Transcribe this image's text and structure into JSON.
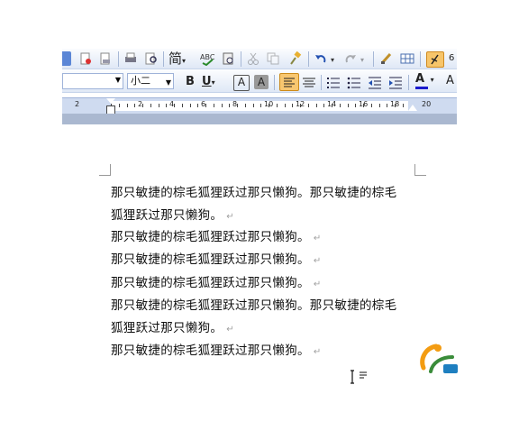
{
  "toolbar": {
    "style_label": "简",
    "font_size": "小二",
    "bold": "B",
    "underline": "U",
    "char_border": "A",
    "char_shade": "A",
    "font_color": "A",
    "zoom_partial": "6",
    "highlight_letter": "A"
  },
  "ruler": {
    "numbers": [
      "2",
      "2",
      "4",
      "6",
      "8",
      "10",
      "12",
      "14",
      "16",
      "18",
      "20"
    ]
  },
  "document": {
    "lines": [
      "那只敏捷的棕毛狐狸跃过那只懒狗。那只敏捷的棕毛",
      "狐狸跃过那只懒狗。",
      "那只敏捷的棕毛狐狸跃过那只懒狗。",
      "那只敏捷的棕毛狐狸跃过那只懒狗。",
      "那只敏捷的棕毛狐狸跃过那只懒狗。",
      "那只敏捷的棕毛狐狸跃过那只懒狗。那只敏捷的棕毛",
      "狐狸跃过那只懒狗。",
      "那只敏捷的棕毛狐狸跃过那只懒狗。"
    ],
    "paragraph_mark": "↵"
  },
  "colors": {
    "toolbar_bg": "#dfe8f6",
    "ruler_bg": "#cfdbf0",
    "logo_orange": "#f39c12",
    "logo_green": "#3a8c3a"
  },
  "icons": [
    "new-doc-icon",
    "print-icon",
    "print-preview-icon",
    "spelling-icon",
    "research-icon",
    "cut-icon",
    "copy-icon",
    "format-painter-icon",
    "undo-icon",
    "redo-icon",
    "table-icon",
    "show-hide-icon",
    "align-left-icon",
    "center-icon",
    "numbering-icon",
    "bullets-icon",
    "decrease-indent-icon",
    "increase-indent-icon",
    "logo-icon",
    "text-cursor-icon"
  ]
}
